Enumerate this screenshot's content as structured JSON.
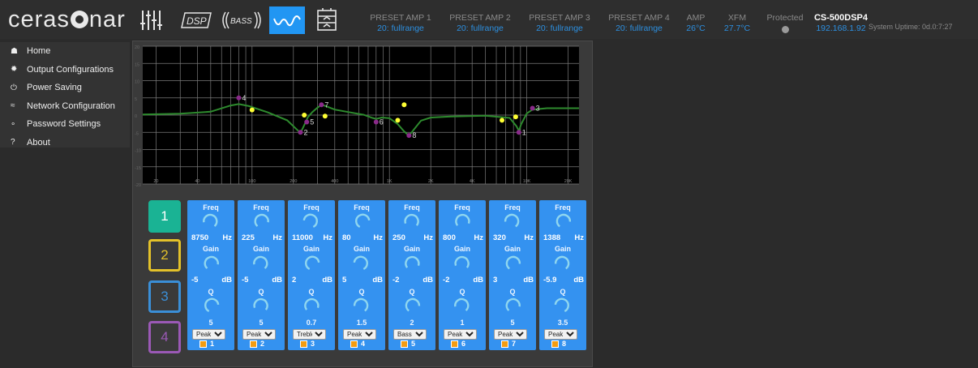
{
  "header": {
    "logo": "cerasonar",
    "tabs": [
      {
        "name": "mixer",
        "icon": "sliders-icon",
        "active": false
      },
      {
        "name": "dsp",
        "label": "DSP",
        "icon": "dsp-icon",
        "active": false
      },
      {
        "name": "bass",
        "label": "BASS",
        "icon": "bass-icon",
        "active": false
      },
      {
        "name": "eq",
        "icon": "eq-curve-icon",
        "active": true
      },
      {
        "name": "amp",
        "icon": "amplifier-icon",
        "active": false
      }
    ],
    "presets": [
      {
        "label": "PRESET AMP 1",
        "value": "20: fullrange"
      },
      {
        "label": "PRESET AMP 2",
        "value": "20: fullrange"
      },
      {
        "label": "PRESET AMP 3",
        "value": "20: fullrange"
      },
      {
        "label": "PRESET AMP 4",
        "value": "20: fullrange"
      }
    ],
    "amp": {
      "label": "AMP",
      "value": "26°C"
    },
    "xfm": {
      "label": "XFM",
      "value": "27.7°C"
    },
    "protected": {
      "label": "Protected"
    },
    "device": {
      "name": "CS-500DSP4",
      "ip": "192.168.1.92"
    },
    "uptime": "System Uptime: 0d.0:7:27"
  },
  "sidebar": {
    "items": [
      {
        "label": "Home",
        "icon": "home-icon"
      },
      {
        "label": "Output Configurations",
        "icon": "gear-icon"
      },
      {
        "label": "Power Saving",
        "icon": "power-icon"
      },
      {
        "label": "Network Configuration",
        "icon": "wifi-icon"
      },
      {
        "label": "Password Settings",
        "icon": "key-icon"
      },
      {
        "label": "About",
        "icon": "question-icon"
      }
    ]
  },
  "chart_data": {
    "type": "line",
    "x_scale": "log",
    "xlim": [
      16,
      24000
    ],
    "ylim": [
      -20,
      20
    ],
    "x_tick_labels": [
      "20",
      "40",
      "100",
      "200",
      "400",
      "1K",
      "2K",
      "4K",
      "10K",
      "20K"
    ],
    "x_ticks": [
      20,
      40,
      100,
      200,
      400,
      1000,
      2000,
      4000,
      10000,
      20000
    ],
    "y_tick_labels": [
      "20",
      "15",
      "10",
      "5",
      "0",
      "-5",
      "-10",
      "-15",
      "-20"
    ],
    "y_ticks": [
      20,
      15,
      10,
      5,
      0,
      -5,
      -10,
      -15,
      -20
    ],
    "grid": true,
    "curve_color": "#2e8b2e",
    "band_points": [
      {
        "label": "1",
        "freq": 8750,
        "gain": -5
      },
      {
        "label": "2",
        "freq": 225,
        "gain": -5
      },
      {
        "label": "3",
        "freq": 11000,
        "gain": 2
      },
      {
        "label": "4",
        "freq": 80,
        "gain": 5
      },
      {
        "label": "5",
        "freq": 250,
        "gain": -2
      },
      {
        "label": "6",
        "freq": 800,
        "gain": -2
      },
      {
        "label": "7",
        "freq": 320,
        "gain": 3
      },
      {
        "label": "8",
        "freq": 1388,
        "gain": -5.9
      }
    ],
    "band_point_color": "#8a2a8a",
    "handle_points": [
      {
        "freq": 100,
        "gain": 1.5
      },
      {
        "freq": 240,
        "gain": 0
      },
      {
        "freq": 340,
        "gain": -0.3
      },
      {
        "freq": 1150,
        "gain": -1.5
      },
      {
        "freq": 1280,
        "gain": 3
      },
      {
        "freq": 6600,
        "gain": -1.5
      },
      {
        "freq": 8300,
        "gain": -0.5
      }
    ],
    "handle_color": "#ffff33",
    "response_curve": [
      [
        16,
        0.2
      ],
      [
        30,
        0.4
      ],
      [
        50,
        1.0
      ],
      [
        70,
        2.8
      ],
      [
        80,
        3.2
      ],
      [
        95,
        2.6
      ],
      [
        130,
        0.8
      ],
      [
        180,
        -1.5
      ],
      [
        212,
        -4.2
      ],
      [
        225,
        -5.2
      ],
      [
        238,
        -3.2
      ],
      [
        255,
        -0.6
      ],
      [
        275,
        0.9
      ],
      [
        300,
        2.2
      ],
      [
        320,
        3.0
      ],
      [
        345,
        2.6
      ],
      [
        400,
        1.6
      ],
      [
        500,
        0.9
      ],
      [
        650,
        0.1
      ],
      [
        750,
        -0.8
      ],
      [
        800,
        -1.1
      ],
      [
        880,
        -0.7
      ],
      [
        1000,
        -0.9
      ],
      [
        1150,
        -2.6
      ],
      [
        1270,
        -4.6
      ],
      [
        1388,
        -6.0
      ],
      [
        1500,
        -4.3
      ],
      [
        1700,
        -1.6
      ],
      [
        2000,
        -0.7
      ],
      [
        2800,
        -0.4
      ],
      [
        5000,
        -0.2
      ],
      [
        7500,
        -0.8
      ],
      [
        8400,
        -3.2
      ],
      [
        8750,
        -4.6
      ],
      [
        9100,
        -2.6
      ],
      [
        10000,
        0.5
      ],
      [
        11000,
        1.6
      ],
      [
        14000,
        2.0
      ],
      [
        24000,
        2.0
      ]
    ]
  },
  "channels": [
    "1",
    "2",
    "3",
    "4"
  ],
  "active_channel": 1,
  "bands": [
    {
      "freq_label": "Freq",
      "freq": "8750",
      "freq_unit": "Hz",
      "gain_label": "Gain",
      "gain": "-5",
      "gain_unit": "dB",
      "q_label": "Q",
      "q": "5",
      "type": "Peak",
      "number": "1"
    },
    {
      "freq_label": "Freq",
      "freq": "225",
      "freq_unit": "Hz",
      "gain_label": "Gain",
      "gain": "-5",
      "gain_unit": "dB",
      "q_label": "Q",
      "q": "5",
      "type": "Peak",
      "number": "2"
    },
    {
      "freq_label": "Freq",
      "freq": "11000",
      "freq_unit": "Hz",
      "gain_label": "Gain",
      "gain": "2",
      "gain_unit": "dB",
      "q_label": "Q",
      "q": "0.7",
      "type": "Treble",
      "number": "3"
    },
    {
      "freq_label": "Freq",
      "freq": "80",
      "freq_unit": "Hz",
      "gain_label": "Gain",
      "gain": "5",
      "gain_unit": "dB",
      "q_label": "Q",
      "q": "1.5",
      "type": "Peak",
      "number": "4"
    },
    {
      "freq_label": "Freq",
      "freq": "250",
      "freq_unit": "Hz",
      "gain_label": "Gain",
      "gain": "-2",
      "gain_unit": "dB",
      "q_label": "Q",
      "q": "2",
      "type": "Bass",
      "number": "5"
    },
    {
      "freq_label": "Freq",
      "freq": "800",
      "freq_unit": "Hz",
      "gain_label": "Gain",
      "gain": "-2",
      "gain_unit": "dB",
      "q_label": "Q",
      "q": "1",
      "type": "Peak",
      "number": "6"
    },
    {
      "freq_label": "Freq",
      "freq": "320",
      "freq_unit": "Hz",
      "gain_label": "Gain",
      "gain": "3",
      "gain_unit": "dB",
      "q_label": "Q",
      "q": "5",
      "type": "Peak",
      "number": "7"
    },
    {
      "freq_label": "Freq",
      "freq": "1388",
      "freq_unit": "Hz",
      "gain_label": "Gain",
      "gain": "-5.9",
      "gain_unit": "dB",
      "q_label": "Q",
      "q": "3.5",
      "type": "Peak",
      "number": "8"
    }
  ],
  "filter_types": [
    "Peak",
    "Bass",
    "Treble"
  ]
}
